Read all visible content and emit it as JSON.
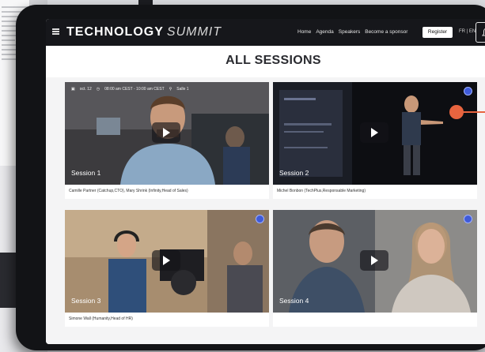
{
  "nav": {
    "logo_bold": "TECHNOLOGY",
    "logo_light": "SUMMIT",
    "links": [
      "Home",
      "Agenda",
      "Speakers",
      "Become a sponsor"
    ],
    "register_label": "Register",
    "language": "FR | EN"
  },
  "page_title": "ALL SESSIONS",
  "sessions": [
    {
      "label": "Session 1",
      "caption": "Camille Partner (Catchup,CTO), Mary Shrink (Infinity,Head of Sales)",
      "meta": [
        "oct. 12",
        "08:00 am CEST - 10:00 am CEST",
        "Salle 1"
      ]
    },
    {
      "label": "Session 2",
      "caption": "Michel Bonbon (TechPlus,Responsable Marketing)"
    },
    {
      "label": "Session 3",
      "caption": "Simone Wall (Humanity,Head of HR)"
    },
    {
      "label": "Session 4",
      "caption": ""
    }
  ],
  "colors": {
    "nav_bg": "#16171b",
    "badge": "#3f5bd9",
    "marker": "#e8643f"
  },
  "icons": [
    "hamburger-icon",
    "bell-icon",
    "play-icon",
    "calendar-icon",
    "clock-icon",
    "location-icon"
  ]
}
